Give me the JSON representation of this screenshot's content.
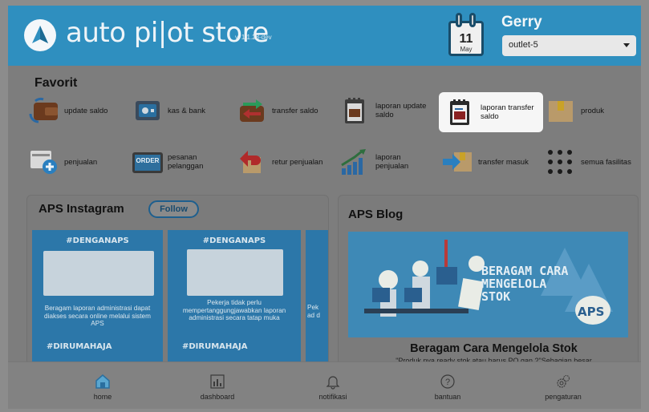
{
  "header": {
    "brand": "auto pi|ot store",
    "version": "v. 1.1.28-dev",
    "calendar": {
      "day": "11",
      "month": "May"
    },
    "user_name": "Gerry",
    "outlet": "outlet-5"
  },
  "favorit": {
    "title": "Favorit",
    "items": [
      {
        "label": "update saldo",
        "icon": "wallet-refresh-icon"
      },
      {
        "label": "kas & bank",
        "icon": "safe-icon"
      },
      {
        "label": "transfer saldo",
        "icon": "wallet-transfer-icon"
      },
      {
        "label": "laporan update saldo",
        "icon": "report-icon"
      },
      {
        "label": "laporan transfer saldo",
        "icon": "report-transfer-icon"
      },
      {
        "label": "produk",
        "icon": "box-icon"
      },
      {
        "label": "penjualan",
        "icon": "sales-add-icon"
      },
      {
        "label": "pesanan pelanggan",
        "icon": "order-icon"
      },
      {
        "label": "retur penjualan",
        "icon": "return-icon"
      },
      {
        "label": "laporan penjualan",
        "icon": "growth-chart-icon"
      },
      {
        "label": "transfer masuk",
        "icon": "incoming-transfer-icon"
      },
      {
        "label": "semua fasilitas",
        "icon": "grid-dots-icon"
      }
    ]
  },
  "instagram": {
    "title": "APS Instagram",
    "follow_label": "Follow",
    "posts": [
      {
        "tag": "#DENGANAPS",
        "text": "Beragam laporan administrasi dapat diakses secara online melalui sistem APS",
        "bottom": "#DIRUMAHAJA"
      },
      {
        "tag": "#DENGANAPS",
        "text": "Pekerja tidak perlu mempertanggungjawabkan laporan administrasi secara tatap muka",
        "bottom": "#DIRUMAHAJA"
      },
      {
        "tag": "",
        "text": "Pek ad d",
        "bottom": ""
      }
    ]
  },
  "blog": {
    "title": "APS Blog",
    "image_text": "BERAGAM CARA MENGELOLA STOK",
    "badge": "APS",
    "headline": "Beragam Cara Mengelola Stok",
    "excerpt": "\"Produk nya ready stok atau harus PO gan ?\"Sebagian besar"
  },
  "bottom_nav": [
    {
      "label": "home",
      "icon": "home-icon"
    },
    {
      "label": "dashboard",
      "icon": "bar-chart-icon"
    },
    {
      "label": "notifikasi",
      "icon": "bell-icon"
    },
    {
      "label": "bantuan",
      "icon": "help-icon"
    },
    {
      "label": "pengaturan",
      "icon": "gears-icon"
    }
  ],
  "colors": {
    "header": "#2f8fbf",
    "overlay_background": "#7d7d7d",
    "accent_dark": "#194c69"
  }
}
